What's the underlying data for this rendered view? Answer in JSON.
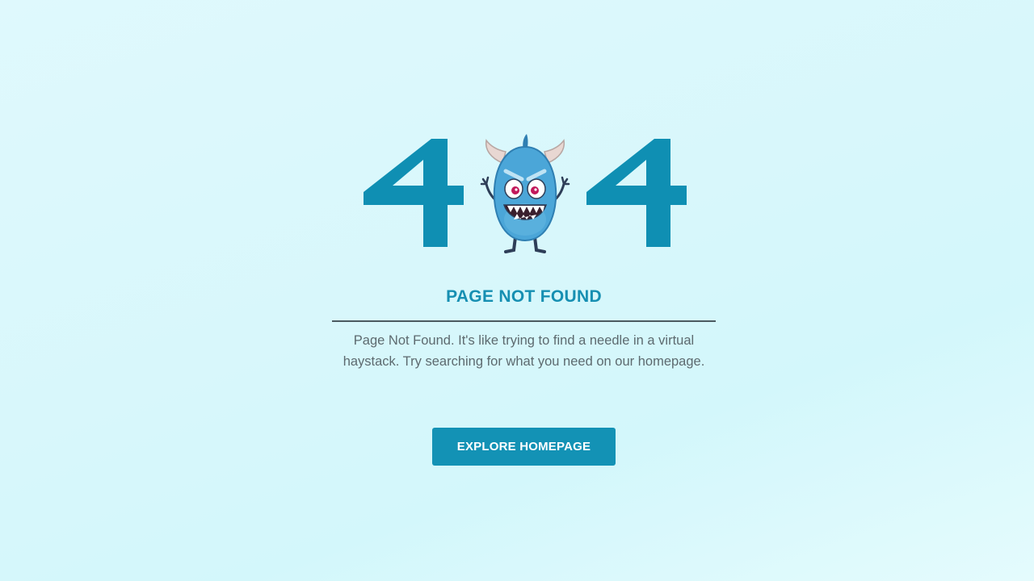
{
  "error": {
    "code_left_digit": "4",
    "code_right_digit": "4",
    "illustration_icon": "monster-icon"
  },
  "title": "PAGE NOT FOUND",
  "description": "Page Not Found. It's like trying to find a needle in a virtual haystack. Try searching for what you need on our homepage.",
  "cta": {
    "label": "EXPLORE HOMEPAGE"
  },
  "colors": {
    "accent": "#1392b5",
    "digit": "#0f8fb3",
    "title": "#168fb2",
    "text": "#5d6a6f",
    "background": "#dcf8fc"
  }
}
